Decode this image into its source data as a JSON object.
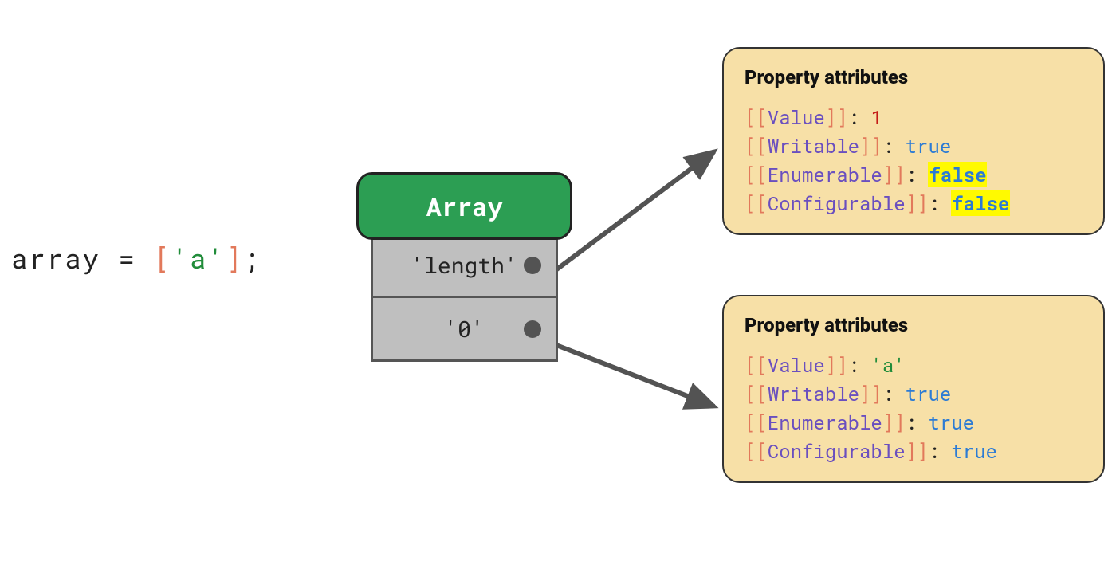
{
  "code": {
    "var": "array",
    "eq": "=",
    "open": "[",
    "value": "'a'",
    "close": "]",
    "semi": ";"
  },
  "object": {
    "header": "Array",
    "rows": [
      {
        "label": "'length'"
      },
      {
        "label": "'0'"
      }
    ]
  },
  "panels": {
    "title": "Property attributes",
    "attrs": {
      "value": "Value",
      "writable": "Writable",
      "enumerable": "Enumerable",
      "configurable": "Configurable"
    },
    "length": {
      "value": "1",
      "writable": "true",
      "enumerable": "false",
      "configurable": "false"
    },
    "index0": {
      "value": "'a'",
      "writable": "true",
      "enumerable": "true",
      "configurable": "true"
    }
  }
}
